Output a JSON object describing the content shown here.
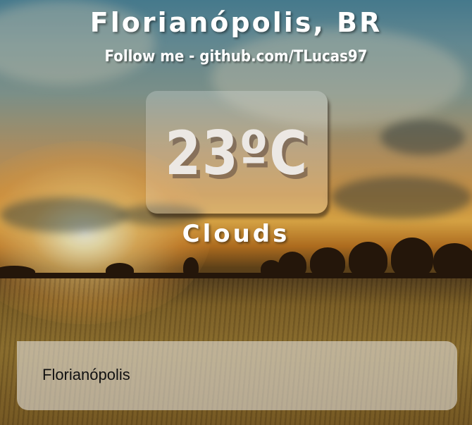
{
  "header": {
    "city": "Florianópolis, BR",
    "follow": "Follow me - github.com/TLucas97"
  },
  "weather": {
    "temperature": "23ºC",
    "description": "Clouds"
  },
  "search": {
    "value": "Florianópolis",
    "placeholder": ""
  },
  "background": {
    "scene": "sunset-wheat-field",
    "accent": "#f2b84d"
  }
}
